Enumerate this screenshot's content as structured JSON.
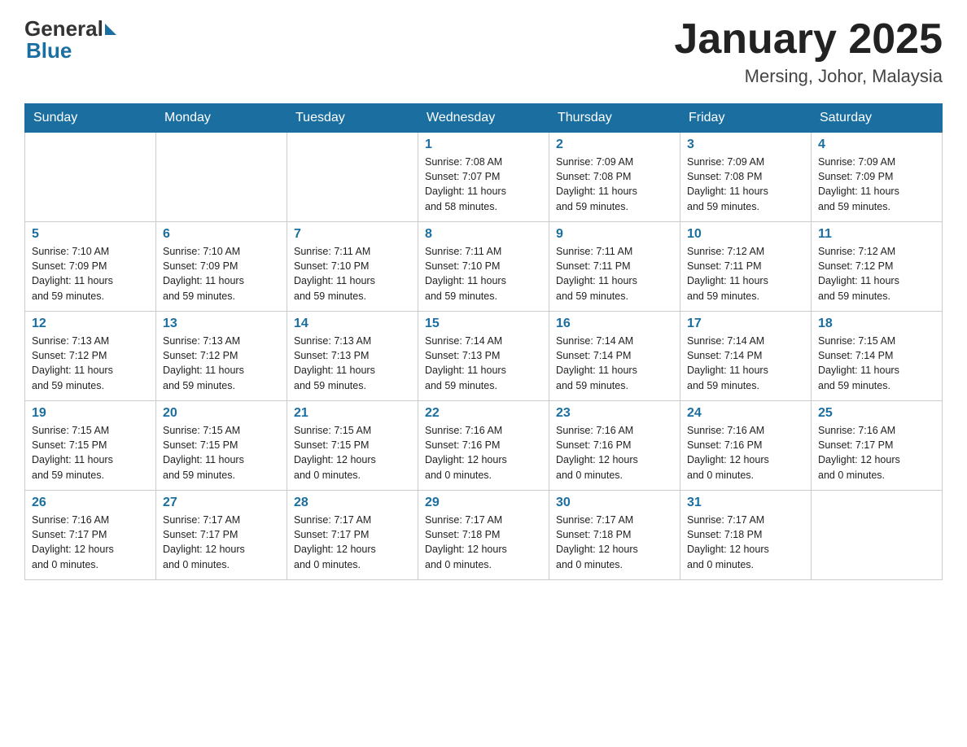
{
  "header": {
    "logo_general": "General",
    "logo_blue": "Blue",
    "month_title": "January 2025",
    "location": "Mersing, Johor, Malaysia"
  },
  "days_of_week": [
    "Sunday",
    "Monday",
    "Tuesday",
    "Wednesday",
    "Thursday",
    "Friday",
    "Saturday"
  ],
  "weeks": [
    [
      {
        "day": "",
        "info": ""
      },
      {
        "day": "",
        "info": ""
      },
      {
        "day": "",
        "info": ""
      },
      {
        "day": "1",
        "info": "Sunrise: 7:08 AM\nSunset: 7:07 PM\nDaylight: 11 hours\nand 58 minutes."
      },
      {
        "day": "2",
        "info": "Sunrise: 7:09 AM\nSunset: 7:08 PM\nDaylight: 11 hours\nand 59 minutes."
      },
      {
        "day": "3",
        "info": "Sunrise: 7:09 AM\nSunset: 7:08 PM\nDaylight: 11 hours\nand 59 minutes."
      },
      {
        "day": "4",
        "info": "Sunrise: 7:09 AM\nSunset: 7:09 PM\nDaylight: 11 hours\nand 59 minutes."
      }
    ],
    [
      {
        "day": "5",
        "info": "Sunrise: 7:10 AM\nSunset: 7:09 PM\nDaylight: 11 hours\nand 59 minutes."
      },
      {
        "day": "6",
        "info": "Sunrise: 7:10 AM\nSunset: 7:09 PM\nDaylight: 11 hours\nand 59 minutes."
      },
      {
        "day": "7",
        "info": "Sunrise: 7:11 AM\nSunset: 7:10 PM\nDaylight: 11 hours\nand 59 minutes."
      },
      {
        "day": "8",
        "info": "Sunrise: 7:11 AM\nSunset: 7:10 PM\nDaylight: 11 hours\nand 59 minutes."
      },
      {
        "day": "9",
        "info": "Sunrise: 7:11 AM\nSunset: 7:11 PM\nDaylight: 11 hours\nand 59 minutes."
      },
      {
        "day": "10",
        "info": "Sunrise: 7:12 AM\nSunset: 7:11 PM\nDaylight: 11 hours\nand 59 minutes."
      },
      {
        "day": "11",
        "info": "Sunrise: 7:12 AM\nSunset: 7:12 PM\nDaylight: 11 hours\nand 59 minutes."
      }
    ],
    [
      {
        "day": "12",
        "info": "Sunrise: 7:13 AM\nSunset: 7:12 PM\nDaylight: 11 hours\nand 59 minutes."
      },
      {
        "day": "13",
        "info": "Sunrise: 7:13 AM\nSunset: 7:12 PM\nDaylight: 11 hours\nand 59 minutes."
      },
      {
        "day": "14",
        "info": "Sunrise: 7:13 AM\nSunset: 7:13 PM\nDaylight: 11 hours\nand 59 minutes."
      },
      {
        "day": "15",
        "info": "Sunrise: 7:14 AM\nSunset: 7:13 PM\nDaylight: 11 hours\nand 59 minutes."
      },
      {
        "day": "16",
        "info": "Sunrise: 7:14 AM\nSunset: 7:14 PM\nDaylight: 11 hours\nand 59 minutes."
      },
      {
        "day": "17",
        "info": "Sunrise: 7:14 AM\nSunset: 7:14 PM\nDaylight: 11 hours\nand 59 minutes."
      },
      {
        "day": "18",
        "info": "Sunrise: 7:15 AM\nSunset: 7:14 PM\nDaylight: 11 hours\nand 59 minutes."
      }
    ],
    [
      {
        "day": "19",
        "info": "Sunrise: 7:15 AM\nSunset: 7:15 PM\nDaylight: 11 hours\nand 59 minutes."
      },
      {
        "day": "20",
        "info": "Sunrise: 7:15 AM\nSunset: 7:15 PM\nDaylight: 11 hours\nand 59 minutes."
      },
      {
        "day": "21",
        "info": "Sunrise: 7:15 AM\nSunset: 7:15 PM\nDaylight: 12 hours\nand 0 minutes."
      },
      {
        "day": "22",
        "info": "Sunrise: 7:16 AM\nSunset: 7:16 PM\nDaylight: 12 hours\nand 0 minutes."
      },
      {
        "day": "23",
        "info": "Sunrise: 7:16 AM\nSunset: 7:16 PM\nDaylight: 12 hours\nand 0 minutes."
      },
      {
        "day": "24",
        "info": "Sunrise: 7:16 AM\nSunset: 7:16 PM\nDaylight: 12 hours\nand 0 minutes."
      },
      {
        "day": "25",
        "info": "Sunrise: 7:16 AM\nSunset: 7:17 PM\nDaylight: 12 hours\nand 0 minutes."
      }
    ],
    [
      {
        "day": "26",
        "info": "Sunrise: 7:16 AM\nSunset: 7:17 PM\nDaylight: 12 hours\nand 0 minutes."
      },
      {
        "day": "27",
        "info": "Sunrise: 7:17 AM\nSunset: 7:17 PM\nDaylight: 12 hours\nand 0 minutes."
      },
      {
        "day": "28",
        "info": "Sunrise: 7:17 AM\nSunset: 7:17 PM\nDaylight: 12 hours\nand 0 minutes."
      },
      {
        "day": "29",
        "info": "Sunrise: 7:17 AM\nSunset: 7:18 PM\nDaylight: 12 hours\nand 0 minutes."
      },
      {
        "day": "30",
        "info": "Sunrise: 7:17 AM\nSunset: 7:18 PM\nDaylight: 12 hours\nand 0 minutes."
      },
      {
        "day": "31",
        "info": "Sunrise: 7:17 AM\nSunset: 7:18 PM\nDaylight: 12 hours\nand 0 minutes."
      },
      {
        "day": "",
        "info": ""
      }
    ]
  ]
}
